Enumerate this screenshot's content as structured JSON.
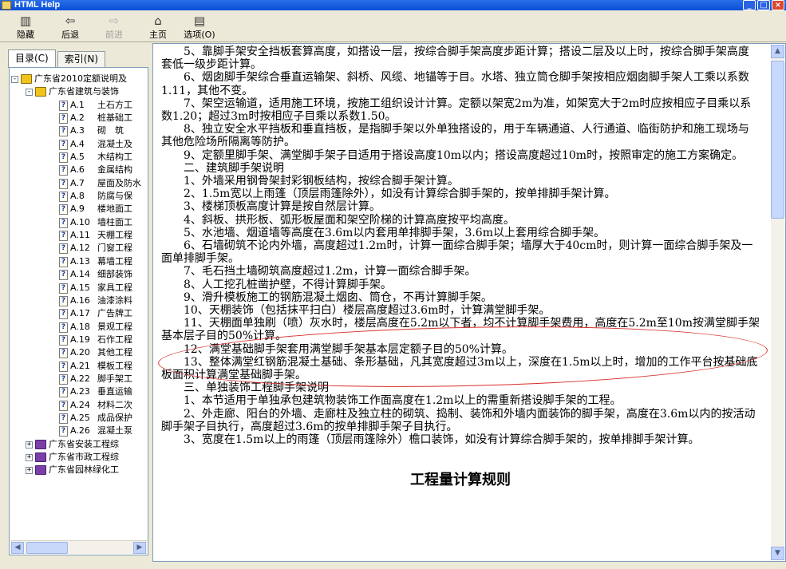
{
  "window": {
    "title": "HTML Help"
  },
  "toolbar": {
    "items": [
      {
        "label": "隐藏",
        "icon": "hide-icon"
      },
      {
        "label": "后退",
        "icon": "back-arrow-icon"
      },
      {
        "label": "前进",
        "icon": "forward-arrow-icon"
      },
      {
        "label": "主页",
        "icon": "home-icon"
      },
      {
        "label": "选项(O)",
        "icon": "options-icon"
      }
    ]
  },
  "tabs": [
    {
      "label": "目录(C)"
    },
    {
      "label": "索引(N)"
    }
  ],
  "tree": {
    "root": "广东省2010定额说明及",
    "child": "广东省建筑与装饰",
    "items": [
      {
        "code": "A.1",
        "label": "土石方工"
      },
      {
        "code": "A.2",
        "label": "桩基础工"
      },
      {
        "code": "A.3",
        "label": "砌　筑"
      },
      {
        "code": "A.4",
        "label": "混凝土及"
      },
      {
        "code": "A.5",
        "label": "木结构工"
      },
      {
        "code": "A.6",
        "label": "金属结构"
      },
      {
        "code": "A.7",
        "label": "屋面及防水"
      },
      {
        "code": "A.8",
        "label": "防腐与保"
      },
      {
        "code": "A.9",
        "label": "楼地面工"
      },
      {
        "code": "A.10",
        "label": "墙柱面工"
      },
      {
        "code": "A.11",
        "label": "天棚工程"
      },
      {
        "code": "A.12",
        "label": "门窗工程"
      },
      {
        "code": "A.13",
        "label": "幕墙工程"
      },
      {
        "code": "A.14",
        "label": "细部装饰"
      },
      {
        "code": "A.15",
        "label": "家具工程"
      },
      {
        "code": "A.16",
        "label": "油漆涂料"
      },
      {
        "code": "A.17",
        "label": "广告牌工"
      },
      {
        "code": "A.18",
        "label": "景观工程"
      },
      {
        "code": "A.19",
        "label": "石作工程"
      },
      {
        "code": "A.20",
        "label": "其他工程"
      },
      {
        "code": "A.21",
        "label": "模板工程"
      },
      {
        "code": "A.22",
        "label": "脚手架工"
      },
      {
        "code": "A.23",
        "label": "垂直运输"
      },
      {
        "code": "A.24",
        "label": "材料二次"
      },
      {
        "code": "A.25",
        "label": "成品保护"
      },
      {
        "code": "A.26",
        "label": "混凝土泵"
      }
    ],
    "others": [
      "广东省安装工程综",
      "广东省市政工程综",
      "广东省园林绿化工"
    ]
  },
  "content": {
    "paragraphs": [
      "5、靠脚手架安全挡板套算高度，如搭设一层，按综合脚手架高度步距计算；搭设二层及以上时，按综合脚手架高度套低一级步距计算。",
      "6、烟囱脚手架综合垂直运输架、斜桥、风缆、地锚等于目。水塔、独立筒仓脚手架按相应烟囱脚手架人工乘以系数1.11，其他不变。",
      "7、架空运输道，适用施工环境，按施工组织设计计算。定额以架宽2m为准，如架宽大于2m时应按相应子目乘以系数1.20；超过3m时按相应子目乘以系数1.50。",
      "8、独立安全水平挡板和垂直挡板，是指脚手架以外单独搭设的，用于车辆通道、人行通道、临街防护和施工现场与其他危险场所隔离等防护。",
      "9、定额里脚手架、满堂脚手架子目适用于搭设高度10m以内；搭设高度超过10m时，按照审定的施工方案确定。",
      "二、建筑脚手架说明",
      "1、外墙采用钢骨架封彩钢板结构，按综合脚手架计算。",
      "2、1.5m宽以上雨篷（顶层雨篷除外），如没有计算综合脚手架的，按单排脚手架计算。",
      "3、楼梯顶板高度计算是按自然层计算。",
      "4、斜板、拱形板、弧形板屋面和架空阶梯的计算高度按平均高度。",
      "5、水池墙、烟道墙等高度在3.6m以内套用单排脚手架，3.6m以上套用综合脚手架。",
      "6、石墙砌筑不论内外墙，高度超过1.2m时，计算一面综合脚手架；墙厚大于40cm时，则计算一面综合脚手架及一面单排脚手架。",
      "7、毛石挡土墙砌筑高度超过1.2m，计算一面综合脚手架。",
      "8、人工挖孔桩凿护壁，不得计算脚手架。",
      "9、滑升模板施工的钢筋混凝土烟囱、筒仓，不再计算脚手架。",
      "10、天棚装饰（包括抹平扫白）楼层高度超过3.6m时，计算满堂脚手架。",
      "11、天棚面单独刷（喷）灰水时，楼层高度在5.2m以下者，均不计算脚手架费用，高度在5.2m至10m按满堂脚手架基本层子目的50%计算。",
      "12、满堂基础脚手架套用满堂脚手架基本层定额子目的50%计算。",
      "13、整体满堂红钢筋混凝土基础、条形基础，凡其宽度超过3m以上，深度在1.5m以上时，增加的工作平台按基础底板面积计算满堂基础脚手架。",
      "三、单独装饰工程脚手架说明",
      "1、本节适用于单独承包建筑物装饰工作面高度在1.2m以上的需重新搭设脚手架的工程。",
      "2、外走廊、阳台的外墙、走廊柱及独立柱的砌筑、捣制、装饰和外墙内面装饰的脚手架，高度在3.6m以内的按活动脚手架子目执行，高度超过3.6m的按单排脚手架子目执行。",
      "3、宽度在1.5m以上的雨篷（顶层雨篷除外）檐口装饰，如没有计算综合脚手架的，按单排脚手架计算。"
    ],
    "heading": "工程量计算规则"
  },
  "annotation_color": "#d8302a"
}
